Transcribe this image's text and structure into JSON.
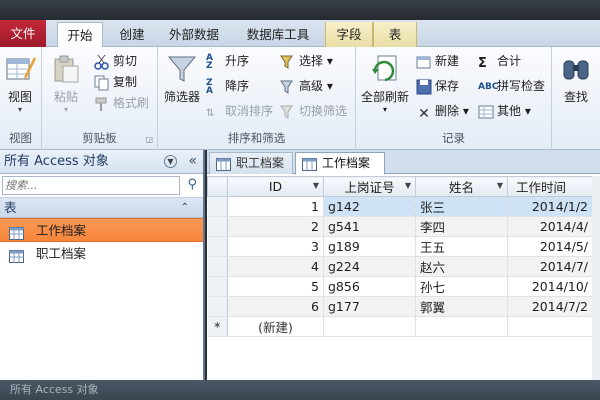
{
  "tabs": [
    "文件",
    "开始",
    "创建",
    "外部数据",
    "数据库工具",
    "字段",
    "表"
  ],
  "ribbon": {
    "views": {
      "button": "视图",
      "group": "视图"
    },
    "clipboard": {
      "paste": "粘贴",
      "cut": "剪切",
      "copy": "复制",
      "format_painter": "格式刷",
      "group": "剪贴板"
    },
    "sort_filter": {
      "filter": "筛选器",
      "asc": "升序",
      "desc": "降序",
      "clear_sort": "取消排序",
      "selection": "选择",
      "advanced": "高级",
      "toggle_filter": "切换筛选",
      "group": "排序和筛选"
    },
    "records": {
      "refresh": "全部刷新",
      "new": "新建",
      "save": "保存",
      "delete": "删除",
      "total": "合计",
      "spelling": "拼写检查",
      "more": "其他",
      "group": "记录"
    },
    "find": {
      "button": "查找"
    }
  },
  "nav": {
    "title": "所有 Access 对象",
    "search_placeholder": "搜索...",
    "section": "表",
    "items": [
      "工作档案",
      "职工档案"
    ],
    "selected": 0
  },
  "doc_tabs": [
    "职工档案",
    "工作档案"
  ],
  "table": {
    "columns": [
      "ID",
      "上岗证号",
      "姓名",
      "工作时间"
    ],
    "rows": [
      [
        "1",
        "g142",
        "张三",
        "2014/1/2"
      ],
      [
        "2",
        "g541",
        "李四",
        "2014/4/"
      ],
      [
        "3",
        "g189",
        "王五",
        "2014/5/"
      ],
      [
        "4",
        "g224",
        "赵六",
        "2014/7/"
      ],
      [
        "5",
        "g856",
        "孙七",
        "2014/10/"
      ],
      [
        "6",
        "g177",
        "郭翼",
        "2014/7/2"
      ]
    ],
    "new_row_marker": "*",
    "new_row_label": "(新建)"
  },
  "statusbar": "所有 Access 对象"
}
